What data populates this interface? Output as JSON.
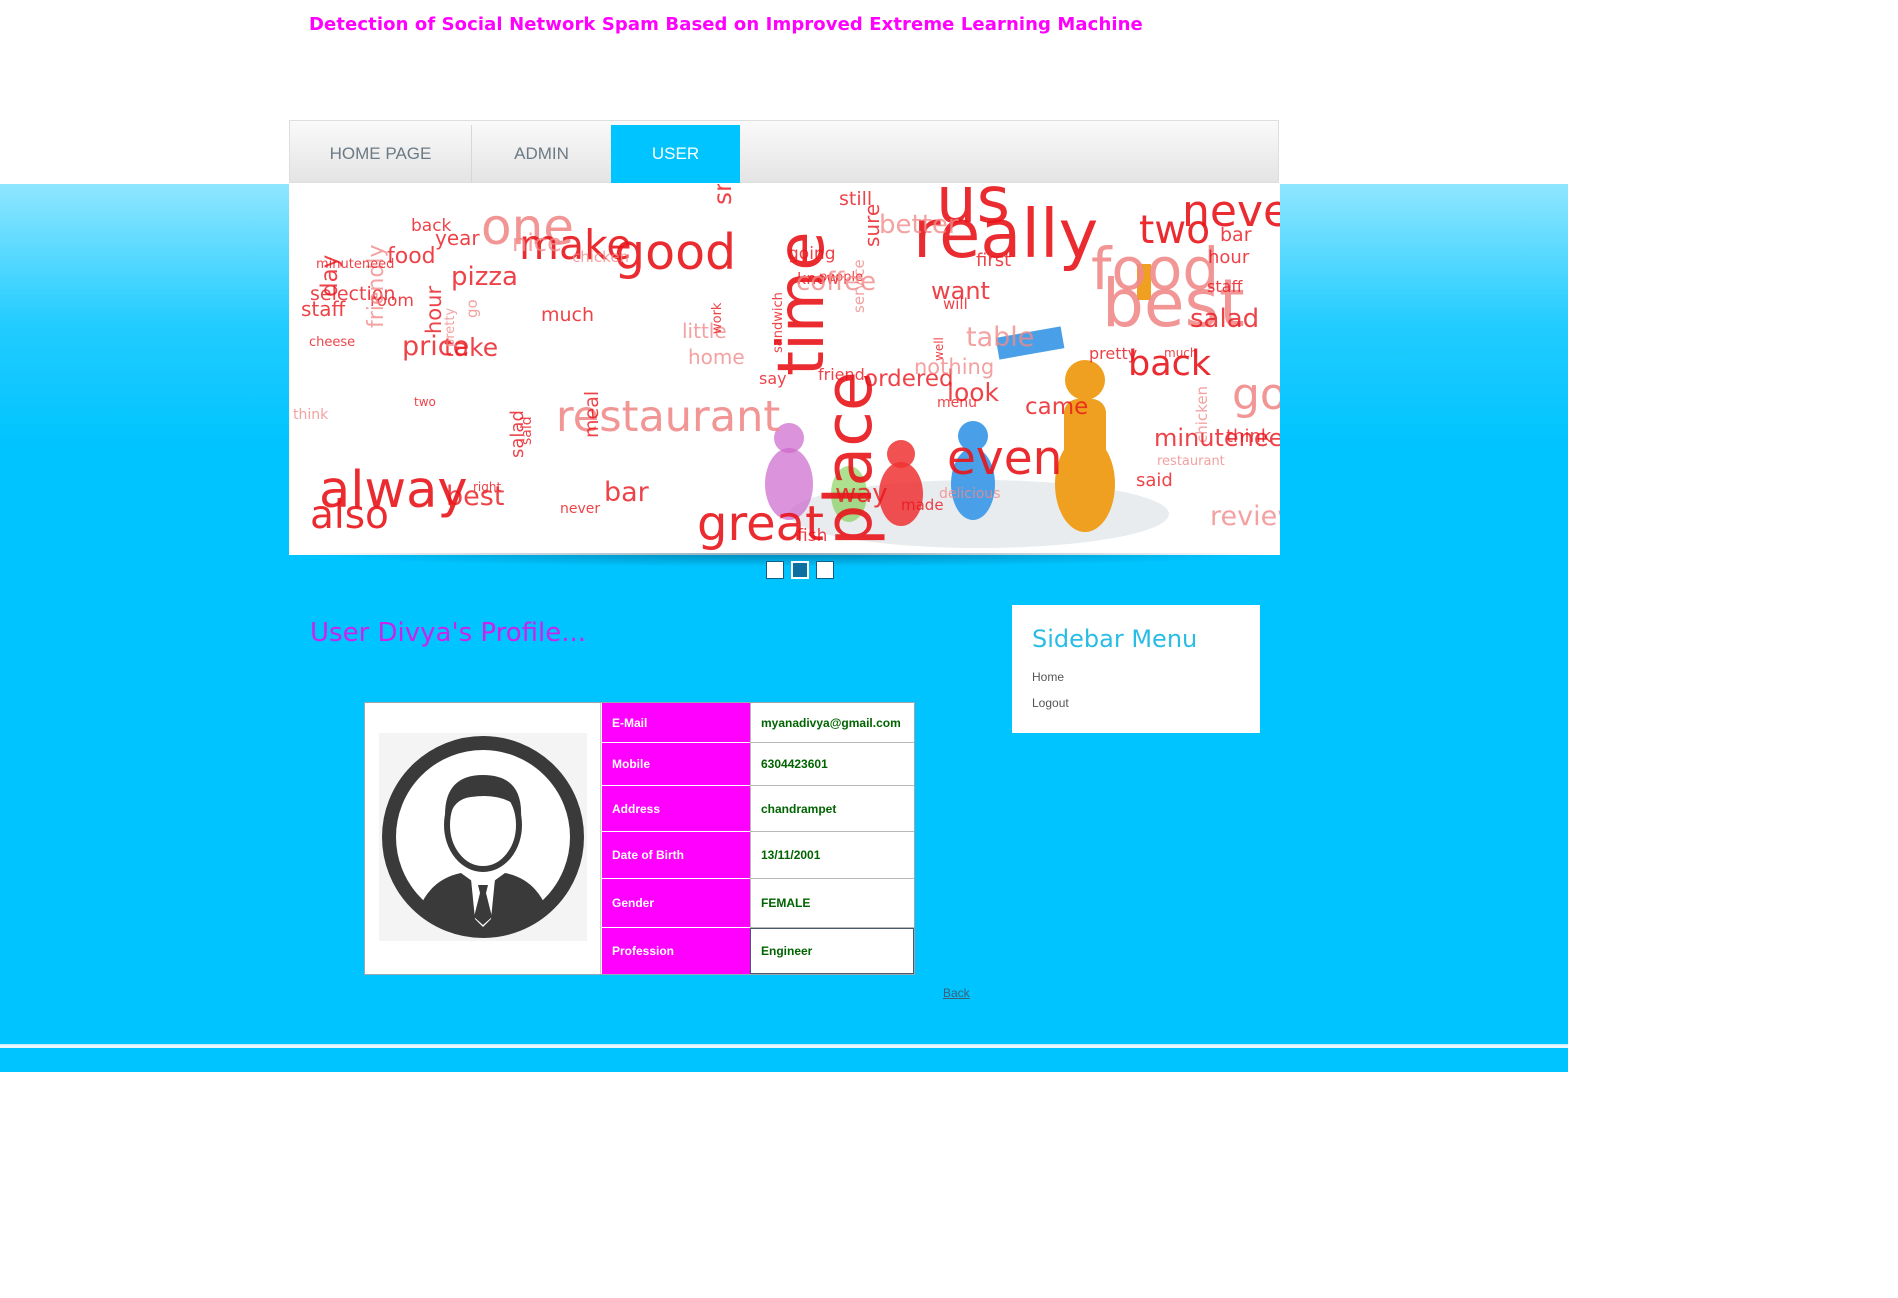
{
  "header": {
    "site_title": "Detection of Social Network Spam Based on Improved Extreme Learning Machine"
  },
  "nav": {
    "items": [
      {
        "label": "HOME PAGE"
      },
      {
        "label": "ADMIN"
      },
      {
        "label": "USER",
        "active": true
      }
    ]
  },
  "banner": {
    "slide_count": 3,
    "active_slide": 2,
    "words_left": [
      "one",
      "alway",
      "restaurant",
      "make",
      "also",
      "good",
      "food",
      "go",
      "back",
      "pizza",
      "nice",
      "cheese",
      "price",
      "take",
      "day",
      "bar",
      "staff",
      "salad",
      "two",
      "best",
      "never",
      "said",
      "chicken",
      "right",
      "selection",
      "room",
      "think",
      "pretty",
      "much",
      "friendly",
      "minuteneed",
      "hour",
      "year",
      "meal"
    ],
    "words_right": [
      "time",
      "place",
      "great",
      "even",
      "us",
      "really",
      "service",
      "little",
      "will",
      "first",
      "better",
      "friend",
      "well",
      "people",
      "delicious",
      "know",
      "made",
      "table",
      "menu",
      "going",
      "want",
      "came",
      "sure",
      "ordered",
      "work",
      "way",
      "coffee",
      "fish",
      "home",
      "say",
      "nothing",
      "still",
      "sandwich",
      "small",
      "look"
    ],
    "words_far_right": [
      "never",
      "good",
      "food",
      "back",
      "best",
      "two",
      "said",
      "salad",
      "staff",
      "bar",
      "chicken",
      "restaurant",
      "pretty",
      "much",
      "minuteneed",
      "review",
      "think",
      "hour"
    ]
  },
  "profile": {
    "title": "User Divya's Profile...",
    "fields": [
      {
        "label": "E-Mail",
        "value": "myanadivya@gmail.com"
      },
      {
        "label": "Mobile",
        "value": "6304423601"
      },
      {
        "label": "Address",
        "value": "chandrampet"
      },
      {
        "label": "Date of Birth",
        "value": "13/11/2001"
      },
      {
        "label": "Gender",
        "value": "FEMALE"
      },
      {
        "label": "Profession",
        "value": "Engineer"
      }
    ],
    "back_label": "Back"
  },
  "sidebar": {
    "title": "Sidebar Menu",
    "links": [
      {
        "label": "Home"
      },
      {
        "label": "Logout"
      }
    ]
  },
  "colors": {
    "title_magenta": "#ff00ff",
    "profile_title": "#cc22ee",
    "accent_blue": "#00c4ff",
    "label_cell": "#ff00ff",
    "value_text": "#006400",
    "sidebar_title": "#29bde6"
  }
}
